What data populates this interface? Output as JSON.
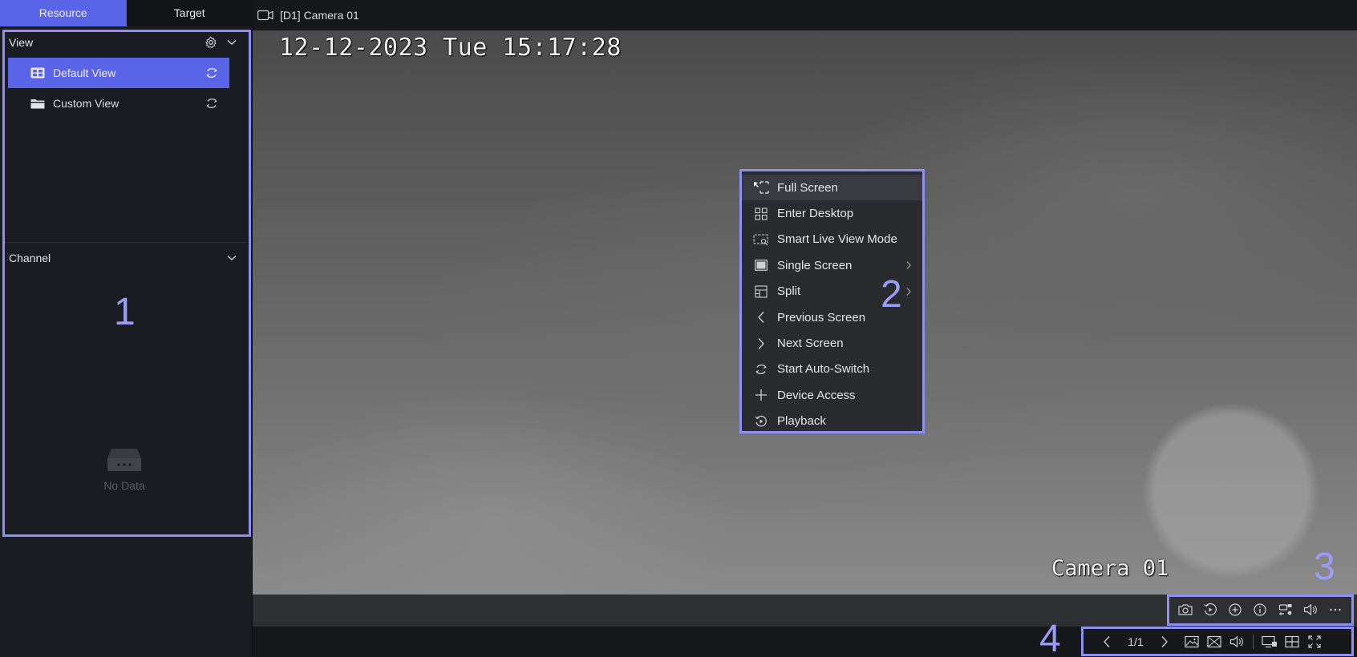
{
  "tabs": [
    {
      "label": "Resource",
      "active": true
    },
    {
      "label": "Target",
      "active": false
    }
  ],
  "view_section": {
    "title": "View",
    "items": [
      {
        "label": "Default View",
        "selected": true
      },
      {
        "label": "Custom View",
        "selected": false
      }
    ]
  },
  "channel_section": {
    "title": "Channel",
    "empty_text": "No Data"
  },
  "camera_tab": {
    "label": "[D1] Camera 01"
  },
  "video_overlay": {
    "timestamp": "12-12-2023 Tue 15:17:28",
    "camera_name": "Camera 01"
  },
  "context_menu": {
    "items": [
      {
        "label": "Full Screen",
        "icon": "full-screen-icon",
        "submenu": false
      },
      {
        "label": "Enter Desktop",
        "icon": "desktop-grid-icon",
        "submenu": false
      },
      {
        "label": "Smart Live View Mode",
        "icon": "smart-view-icon",
        "submenu": false
      },
      {
        "label": "Single Screen",
        "icon": "single-screen-icon",
        "submenu": true
      },
      {
        "label": "Split",
        "icon": "split-icon",
        "submenu": true
      },
      {
        "label": "Previous Screen",
        "icon": "chevron-left-icon",
        "submenu": false
      },
      {
        "label": "Next Screen",
        "icon": "chevron-right-icon",
        "submenu": false
      },
      {
        "label": "Start Auto-Switch",
        "icon": "loop-icon",
        "submenu": false
      },
      {
        "label": "Device Access",
        "icon": "plus-icon",
        "submenu": false
      },
      {
        "label": "Playback",
        "icon": "playback-icon",
        "submenu": false
      }
    ]
  },
  "live_toolbar": {
    "icons": [
      "camera-icon",
      "replay-icon",
      "zoom-in-icon",
      "info-icon",
      "ptz-icon",
      "speaker-icon",
      "more-icon"
    ]
  },
  "bottom_toolbar": {
    "page": "1/1"
  },
  "annotations": [
    "1",
    "2",
    "3",
    "4"
  ],
  "colors": {
    "accent": "#5a64e6",
    "annotation": "#8d90f2",
    "panel_bg": "#1b1c21"
  }
}
